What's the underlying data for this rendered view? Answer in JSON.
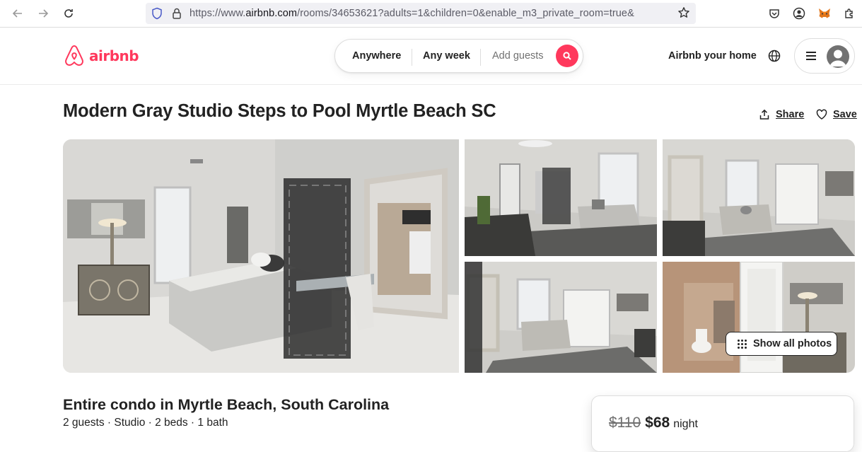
{
  "browser": {
    "url_prefix": "https://www.",
    "url_host": "airbnb.com",
    "url_rest": "/rooms/34653621?adults=1&children=0&enable_m3_private_room=true&"
  },
  "header": {
    "logo_text": "airbnb",
    "search": {
      "anywhere": "Anywhere",
      "any_week": "Any week",
      "add_guests": "Add guests"
    },
    "host_link": "Airbnb your home",
    "brand_color": "#ff385c"
  },
  "listing": {
    "title": "Modern Gray Studio Steps to Pool Myrtle Beach SC",
    "share": "Share",
    "save": "Save",
    "show_all_photos": "Show all photos",
    "type": "Entire condo in Myrtle Beach, South Carolina",
    "details": "2 guests · Studio · 2 beds · 1 bath"
  },
  "booking": {
    "old_price": "$110",
    "new_price": "$68",
    "unit": "night"
  }
}
